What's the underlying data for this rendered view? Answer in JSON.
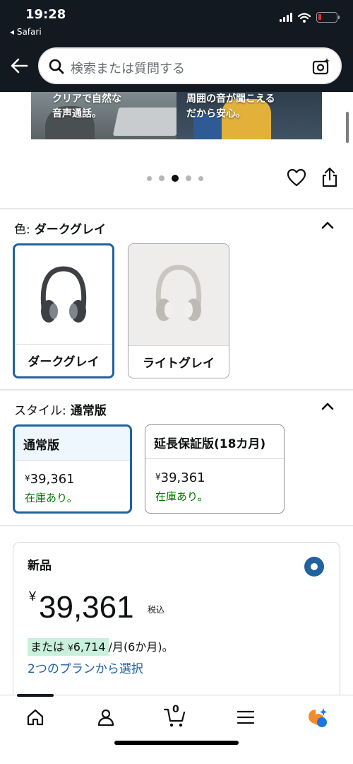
{
  "status_bar": {
    "time": "19:28",
    "back_app": "◂ Safari"
  },
  "search": {
    "placeholder": "検索または質問する"
  },
  "banner": {
    "caption_left": [
      "クリアで自然な",
      "音声通話。"
    ],
    "caption_right": [
      "周囲の音が聞こえる",
      "だから安心。"
    ]
  },
  "carousel": {
    "dot_count": 5,
    "active_index": 2
  },
  "color_selector": {
    "label": "色:",
    "selected": "ダークグレイ",
    "options": [
      {
        "label": "ダークグレイ",
        "color": "#3c3f44"
      },
      {
        "label": "ライトグレイ",
        "color": "#d2d0cd"
      }
    ]
  },
  "style_selector": {
    "label": "スタイル:",
    "selected": "通常版",
    "options": [
      {
        "label": "通常版",
        "currency": "¥",
        "price": "39,361",
        "stock": "在庫あり。"
      },
      {
        "label": "延長保証版(18カ月)",
        "currency": "¥",
        "price": "39,361",
        "stock": "在庫あり。"
      }
    ]
  },
  "offer": {
    "title": "新品",
    "currency": "¥",
    "price": "39,361",
    "tax_label": "税込",
    "installment_prefix": "または ",
    "installment_currency": "¥",
    "installment_amount": "6,714",
    "installment_suffix": "/月(6か月)。",
    "plans_link": "2つのプランから選択"
  },
  "bottom_nav": {
    "cart_count": "0"
  },
  "colors": {
    "header_bg": "#131921",
    "accent_blue": "#2162a1",
    "stock_green": "#007600"
  }
}
